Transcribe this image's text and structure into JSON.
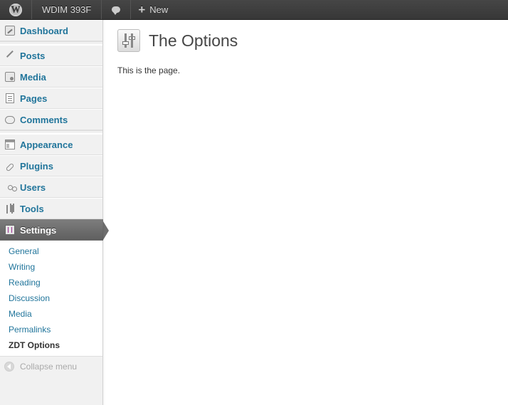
{
  "adminbar": {
    "site_name": "WDIM 393F",
    "new_label": "New",
    "logo_icon": "wordpress-logo-icon",
    "comments_icon": "comment-bubble-icon",
    "new_icon": "plus-icon"
  },
  "sidebar": {
    "items": [
      {
        "label": "Dashboard",
        "icon": "dashboard-icon"
      },
      {
        "label": "Posts",
        "icon": "pushpin-icon"
      },
      {
        "label": "Media",
        "icon": "media-icon"
      },
      {
        "label": "Pages",
        "icon": "pages-icon"
      },
      {
        "label": "Comments",
        "icon": "comment-icon"
      },
      {
        "label": "Appearance",
        "icon": "appearance-icon"
      },
      {
        "label": "Plugins",
        "icon": "plugin-icon"
      },
      {
        "label": "Users",
        "icon": "users-icon"
      },
      {
        "label": "Tools",
        "icon": "tools-icon"
      },
      {
        "label": "Settings",
        "icon": "settings-icon"
      }
    ],
    "submenu": [
      {
        "label": "General"
      },
      {
        "label": "Writing"
      },
      {
        "label": "Reading"
      },
      {
        "label": "Discussion"
      },
      {
        "label": "Media"
      },
      {
        "label": "Permalinks"
      },
      {
        "label": "ZDT Options"
      }
    ],
    "collapse_label": "Collapse menu"
  },
  "main": {
    "title": "The Options",
    "body_text": "This is the page.",
    "title_icon": "options-sliders-icon"
  },
  "colors": {
    "link": "#21759b",
    "current_menu_bg": "#6e6e6e",
    "adminbar_bg": "#464646"
  }
}
